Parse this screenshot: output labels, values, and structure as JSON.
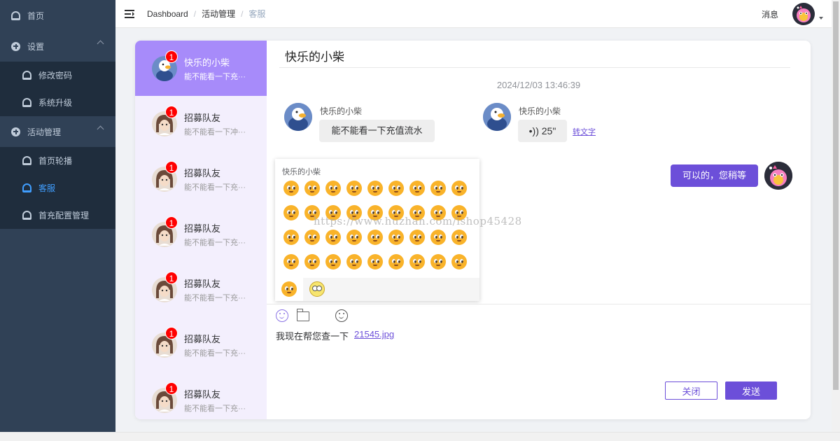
{
  "sidebar": {
    "home": "首页",
    "settings": {
      "label": "设置",
      "items": [
        "修改密码",
        "系统升级"
      ]
    },
    "activity": {
      "label": "活动管理",
      "items": [
        "首页轮播",
        "客服",
        "首充配置管理"
      ],
      "active_index": 1
    }
  },
  "header": {
    "breadcrumb": [
      "Dashboard",
      "活动管理",
      "客服"
    ],
    "messages": "消息"
  },
  "contacts": [
    {
      "name": "快乐的小柴",
      "preview": "能不能看一下充···",
      "badge": "1",
      "avatar": "duck-avatar",
      "active": true
    },
    {
      "name": "招募队友",
      "preview": "能不能看一下冲···",
      "badge": "1",
      "avatar": "girl-avatar",
      "active": false
    },
    {
      "name": "招募队友",
      "preview": "能不能看一下充···",
      "badge": "1",
      "avatar": "girl-avatar",
      "active": false
    },
    {
      "name": "招募队友",
      "preview": "能不能看一下充···",
      "badge": "1",
      "avatar": "girl-avatar",
      "active": false
    },
    {
      "name": "招募队友",
      "preview": "能不能看一下充···",
      "badge": "1",
      "avatar": "girl-avatar",
      "active": false
    },
    {
      "name": "招募队友",
      "preview": "能不能看一下充···",
      "badge": "1",
      "avatar": "girl-avatar",
      "active": false
    },
    {
      "name": "招募队友",
      "preview": "能不能看一下充···",
      "badge": "1",
      "avatar": "girl-avatar",
      "active": false
    }
  ],
  "chat": {
    "title": "快乐的小柴",
    "timestamp": "2024/12/03  13:46:39",
    "messages": [
      {
        "sender": "快乐的小柴",
        "text": "能不能看一下充值流水"
      },
      {
        "sender": "快乐的小柴",
        "voice": "•)) 25\"",
        "action": "转文字"
      },
      {
        "text": "可以的，您稍等",
        "self": true
      }
    ]
  },
  "emoji_panel": {
    "title": "快乐的小柴",
    "count": 36
  },
  "watermark": "https://www.huzhan.com/ishop45428",
  "input": {
    "text": "我现在帮您查一下",
    "file": "21545.jpg"
  },
  "buttons": {
    "close": "关闭",
    "send": "发送"
  },
  "colors": {
    "accent": "#6c4fd9",
    "contact_active": "#a78bfa",
    "sidebar": "#304156",
    "badge": "#ff0000"
  }
}
